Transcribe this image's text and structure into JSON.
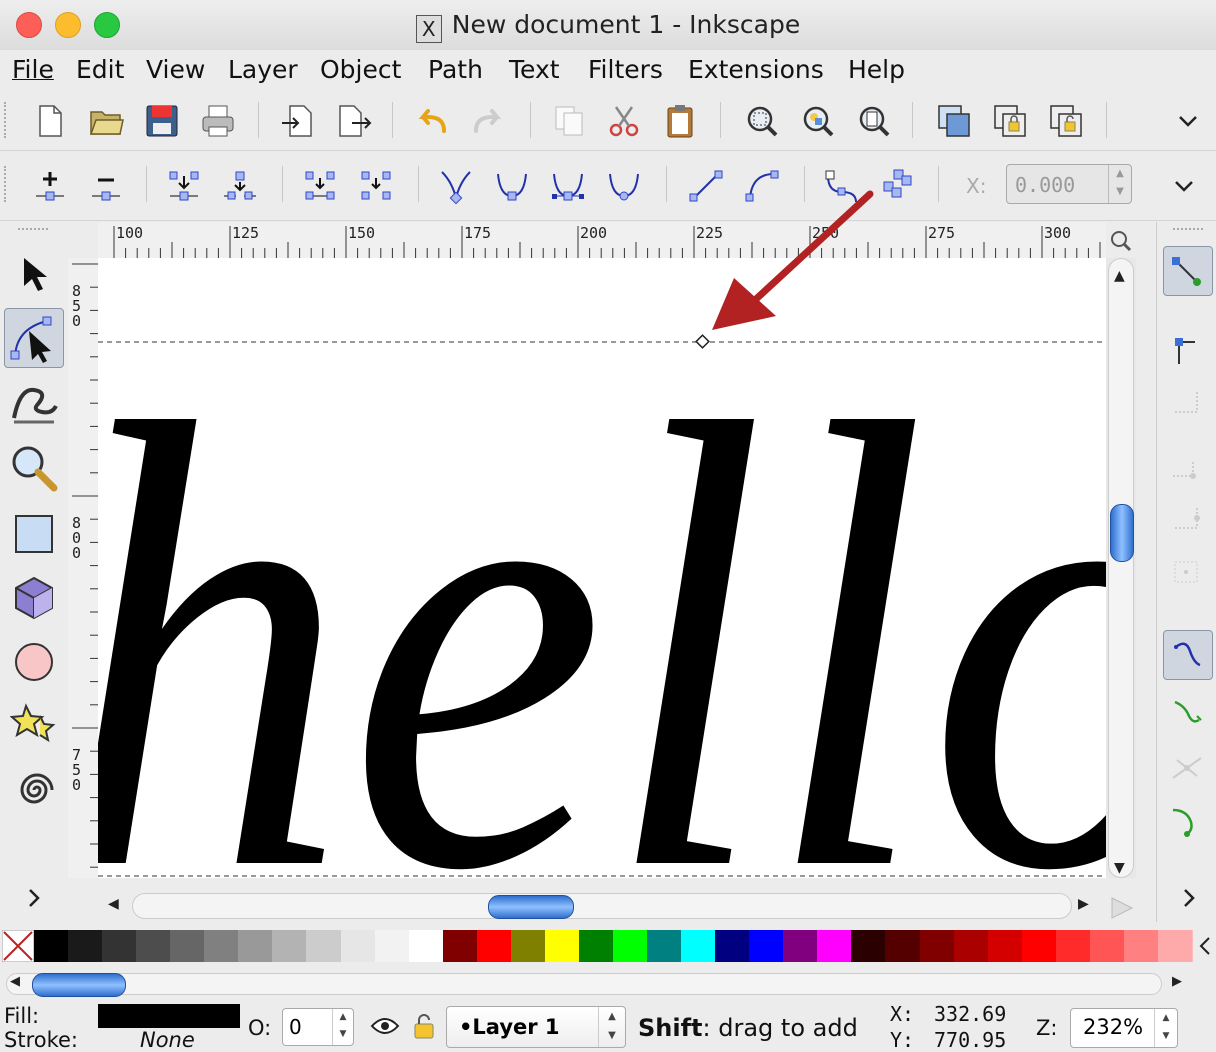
{
  "window": {
    "title": "New document 1 - Inkscape"
  },
  "menu": [
    "File",
    "Edit",
    "View",
    "Layer",
    "Object",
    "Path",
    "Text",
    "Filters",
    "Extensions",
    "Help"
  ],
  "node_toolbar": {
    "x_label": "X:",
    "x_value": "0.000"
  },
  "ruler": {
    "h_labels": [
      "100",
      "125",
      "150",
      "175",
      "200",
      "225",
      "250",
      "275",
      "300"
    ],
    "v_labels": [
      "850",
      "800",
      "750"
    ]
  },
  "canvas": {
    "text": "hello"
  },
  "palette": [
    "#000000",
    "#1a1a1a",
    "#333333",
    "#4d4d4d",
    "#666666",
    "#808080",
    "#999999",
    "#b3b3b3",
    "#cccccc",
    "#e6e6e6",
    "#f2f2f2",
    "#ffffff",
    "#800000",
    "#ff0000",
    "#808000",
    "#ffff00",
    "#008000",
    "#00ff00",
    "#008080",
    "#00ffff",
    "#000080",
    "#0000ff",
    "#800080",
    "#ff00ff",
    "#2b0000",
    "#550000",
    "#800000",
    "#aa0000",
    "#d40000",
    "#ff0000",
    "#ff2a2a",
    "#ff5555",
    "#ff8080",
    "#ffaaaa"
  ],
  "status": {
    "fill_label": "Fill:",
    "stroke_label": "Stroke:",
    "stroke_value": "None",
    "opacity_label": "O:",
    "opacity_value": "0",
    "layer": "•Layer 1",
    "message_bold": "Shift",
    "message_rest": ": drag to add",
    "x_label": "X:",
    "x_value": "332.69",
    "y_label": "Y:",
    "y_value": "770.95",
    "zoom_label": "Z:",
    "zoom_value": "232%"
  },
  "colors": {
    "fill": "#000000",
    "annotation_arrow": "#b22222",
    "accent": "#3a7bd5"
  }
}
